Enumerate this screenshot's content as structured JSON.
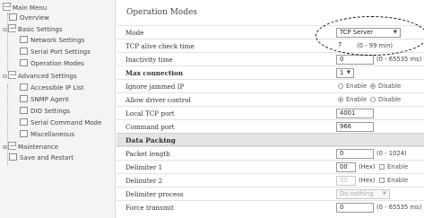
{
  "sidebar": {
    "main_menu": "Main Menu",
    "overview": "Overview",
    "basic_settings": "Basic Settings",
    "network_settings": "Network Settings",
    "serial_port_settings": "Serial Port Settings",
    "operation_modes": "Operation Modes",
    "advanced_settings": "Advanced Settings",
    "accessible_ip_list": "Accessible IP List",
    "snmp_agent": "SNMP Agent",
    "dio_settings": "DIO Settings",
    "serial_command_mode": "Serial Command Mode",
    "miscellaneous": "Miscellaneous",
    "maintenance": "Maintenance",
    "save_and_restart": "Save and Restart"
  },
  "main": {
    "title": "Operation Modes",
    "rows": {
      "mode": {
        "label": "Mode",
        "value": "TCP Server"
      },
      "tcp_alive": {
        "label": "TCP alive check time",
        "value": "7",
        "range": "(0 - 99 min)"
      },
      "inactivity": {
        "label": "Inactivity time",
        "value": "0",
        "range": "(0 - 65535 ms)"
      },
      "max_connection": {
        "label": "Max connection",
        "value": "1"
      },
      "ignore_jammed": {
        "label": "Ignore jammed IP",
        "enable": "Enable",
        "disable": "Disable"
      },
      "allow_driver": {
        "label": "Allow driver control",
        "enable": "Enable",
        "disable": "Disable"
      },
      "local_tcp": {
        "label": "Local TCP port",
        "value": "4001"
      },
      "command_port": {
        "label": "Command port",
        "value": "966"
      }
    },
    "data_packing": {
      "title": "Data Packing",
      "packet_length": {
        "label": "Packet length",
        "value": "0",
        "range": "(0 - 1024)"
      },
      "delimiter1": {
        "label": "Delimiter 1",
        "value": "00",
        "unit": "(Hex)",
        "enable": "Enable"
      },
      "delimiter2": {
        "label": "Delimiter 2",
        "value": "00",
        "unit": "(Hex)",
        "enable": "Enable"
      },
      "delimiter_process": {
        "label": "Delimiter process",
        "value": "Do nothing"
      },
      "force_transmit": {
        "label": "Force transmit",
        "value": "0",
        "range": "(0 - 65535 ms)"
      }
    }
  },
  "colors": {
    "accent": "#111111",
    "sidebar_bg": "#f4f4f4",
    "section_bg": "#e4e4e4"
  }
}
